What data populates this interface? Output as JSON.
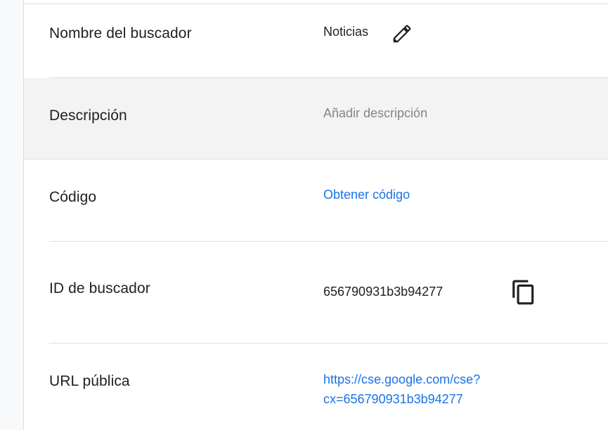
{
  "rows": [
    {
      "label": "Nombre del buscador",
      "value": "Noticias"
    },
    {
      "label": "Descripción",
      "placeholder": "Añadir descripción"
    },
    {
      "label": "Código",
      "link": "Obtener código"
    },
    {
      "label": "ID de buscador",
      "value": "656790931b3b94277"
    },
    {
      "label": "URL pública",
      "url_line1": "https://cse.google.com/cse?",
      "url_line2": "cx=656790931b3b94277"
    }
  ],
  "icons": {
    "edit": "pencil-icon",
    "copy": "copy-icon"
  },
  "colors": {
    "link": "#1a73e8",
    "hover_row": "#f3f3f3",
    "placeholder": "#80868b"
  }
}
